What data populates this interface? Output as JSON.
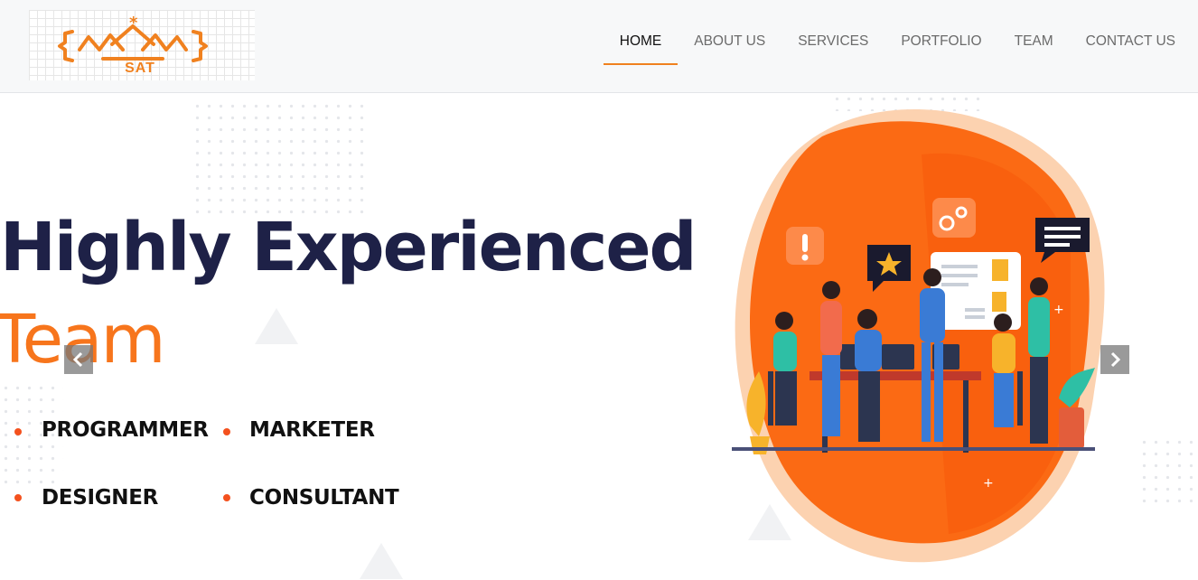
{
  "brand": {
    "logo_text": "SAT"
  },
  "nav": {
    "items": [
      {
        "label": "HOME",
        "active": true
      },
      {
        "label": "ABOUT US",
        "active": false
      },
      {
        "label": "SERVICES",
        "active": false
      },
      {
        "label": "PORTFOLIO",
        "active": false
      },
      {
        "label": "TEAM",
        "active": false
      },
      {
        "label": "CONTACT US",
        "active": false
      }
    ]
  },
  "hero": {
    "headline_line1": "Highly Experienced",
    "headline_line2": "Team",
    "roles": [
      "PROGRAMMER",
      "MARKETER",
      "DESIGNER",
      "CONSULTANT"
    ]
  },
  "colors": {
    "accent": "#f7751c",
    "headline": "#1e2147",
    "bullet": "#f4511e",
    "header_bg": "#f7f8f9"
  },
  "icons": {
    "prev": "chevron-left-icon",
    "next": "chevron-right-icon"
  }
}
